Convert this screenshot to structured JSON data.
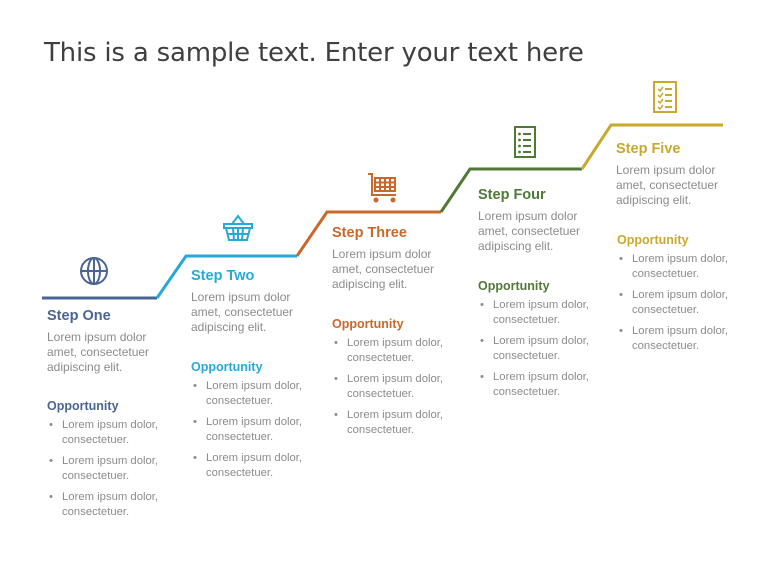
{
  "title": "This is a sample text. Enter your text here",
  "steps": [
    {
      "title": "Step One",
      "color": "#4a6494",
      "icon": "globe-icon",
      "description": "Lorem ipsum dolor amet, consectetuer adipiscing elit.",
      "opportunity_title": "Opportunity",
      "opportunities": [
        "Lorem ipsum dolor, consectetuer.",
        "Lorem ipsum dolor, consectetuer.",
        "Lorem ipsum dolor, consectetuer."
      ]
    },
    {
      "title": "Step Two",
      "color": "#27a9d8",
      "icon": "basket-icon",
      "description": "Lorem ipsum dolor amet, consectetuer adipiscing elit.",
      "opportunity_title": "Opportunity",
      "opportunities": [
        "Lorem ipsum dolor, consectetuer.",
        "Lorem ipsum dolor, consectetuer.",
        "Lorem ipsum dolor, consectetuer."
      ]
    },
    {
      "title": "Step Three",
      "color": "#c8682a",
      "icon": "shopping-cart-icon",
      "description": "Lorem ipsum dolor amet, consectetuer adipiscing elit.",
      "opportunity_title": "Opportunity",
      "opportunities": [
        "Lorem ipsum dolor, consectetuer.",
        "Lorem ipsum dolor, consectetuer.",
        "Lorem ipsum dolor, consectetuer."
      ]
    },
    {
      "title": "Step Four",
      "color": "#4e7a36",
      "icon": "list-document-icon",
      "description": "Lorem ipsum dolor amet, consectetuer adipiscing elit.",
      "opportunity_title": "Opportunity",
      "opportunities": [
        "Lorem ipsum dolor, consectetuer.",
        "Lorem ipsum dolor, consectetuer.",
        "Lorem ipsum dolor, consectetuer."
      ]
    },
    {
      "title": "Step Five",
      "color": "#c9a92c",
      "icon": "checklist-icon",
      "description": "Lorem ipsum dolor amet, consectetuer adipiscing elit.",
      "opportunity_title": "Opportunity",
      "opportunities": [
        "Lorem ipsum dolor, consectetuer.",
        "Lorem ipsum dolor, consectetuer.",
        "Lorem ipsum dolor, consectetuer."
      ]
    }
  ]
}
